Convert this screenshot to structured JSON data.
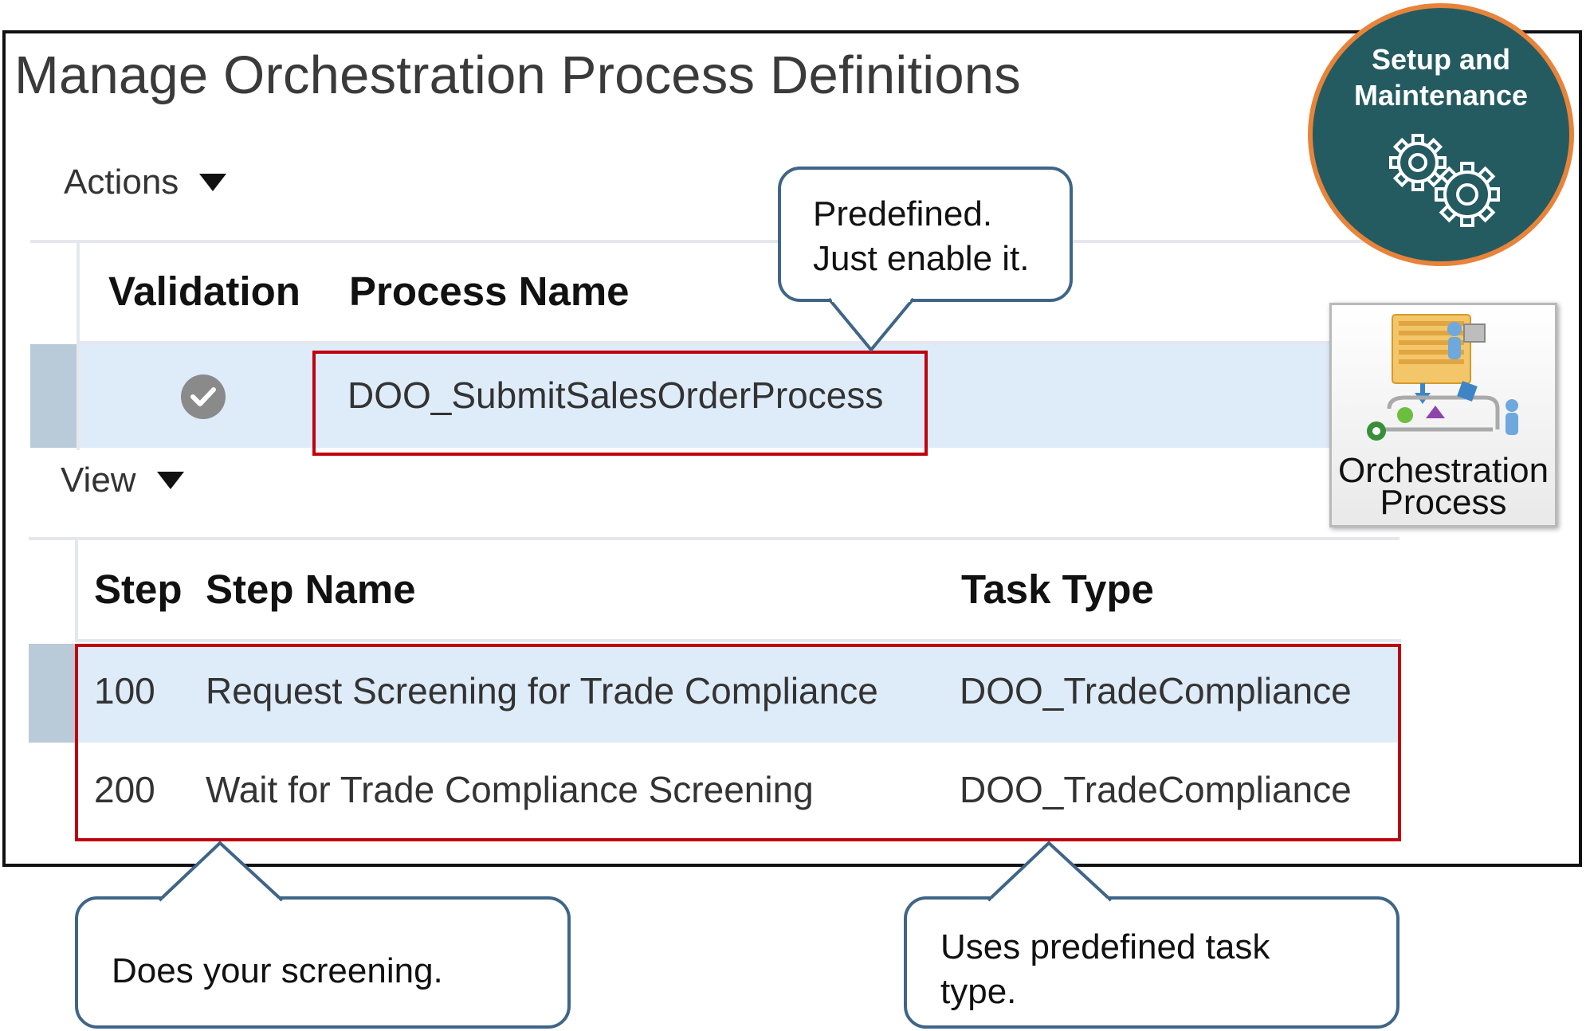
{
  "page": {
    "title": "Manage Orchestration Process Definitions"
  },
  "actions_menu": {
    "label": "Actions",
    "icon": "triangle-down-icon"
  },
  "view_menu": {
    "label": "View",
    "icon": "triangle-down-icon"
  },
  "process_table": {
    "columns": [
      "Validation",
      "Process Name"
    ],
    "rows": [
      {
        "validation_icon": "check-circle-icon",
        "process_name": "DOO_SubmitSalesOrderProcess"
      }
    ]
  },
  "steps_table": {
    "columns": [
      "Step",
      "Step Name",
      "Task Type"
    ],
    "rows": [
      {
        "step": "100",
        "step_name": "Request Screening for Trade Compliance",
        "task_type": "DOO_TradeCompliance"
      },
      {
        "step": "200",
        "step_name": "Wait for Trade Compliance Screening",
        "task_type": "DOO_TradeCompliance"
      }
    ]
  },
  "callouts": {
    "predefined": {
      "line1": "Predefined.",
      "line2": "Just enable it."
    },
    "screening": "Does your screening.",
    "task_type": {
      "line1": "Uses predefined task",
      "line2": "type."
    }
  },
  "badge": {
    "line1": "Setup and",
    "line2": "Maintenance",
    "icon": "gears-icon"
  },
  "tile": {
    "line1": "Orchestration",
    "line2": "Process",
    "icon": "orchestration-process-icon"
  },
  "colors": {
    "selected_row": "#deebf9",
    "highlight_border": "#c0000c",
    "callout_border": "#3f6587",
    "badge_fill": "#245b61",
    "badge_ring": "#e8833a"
  }
}
